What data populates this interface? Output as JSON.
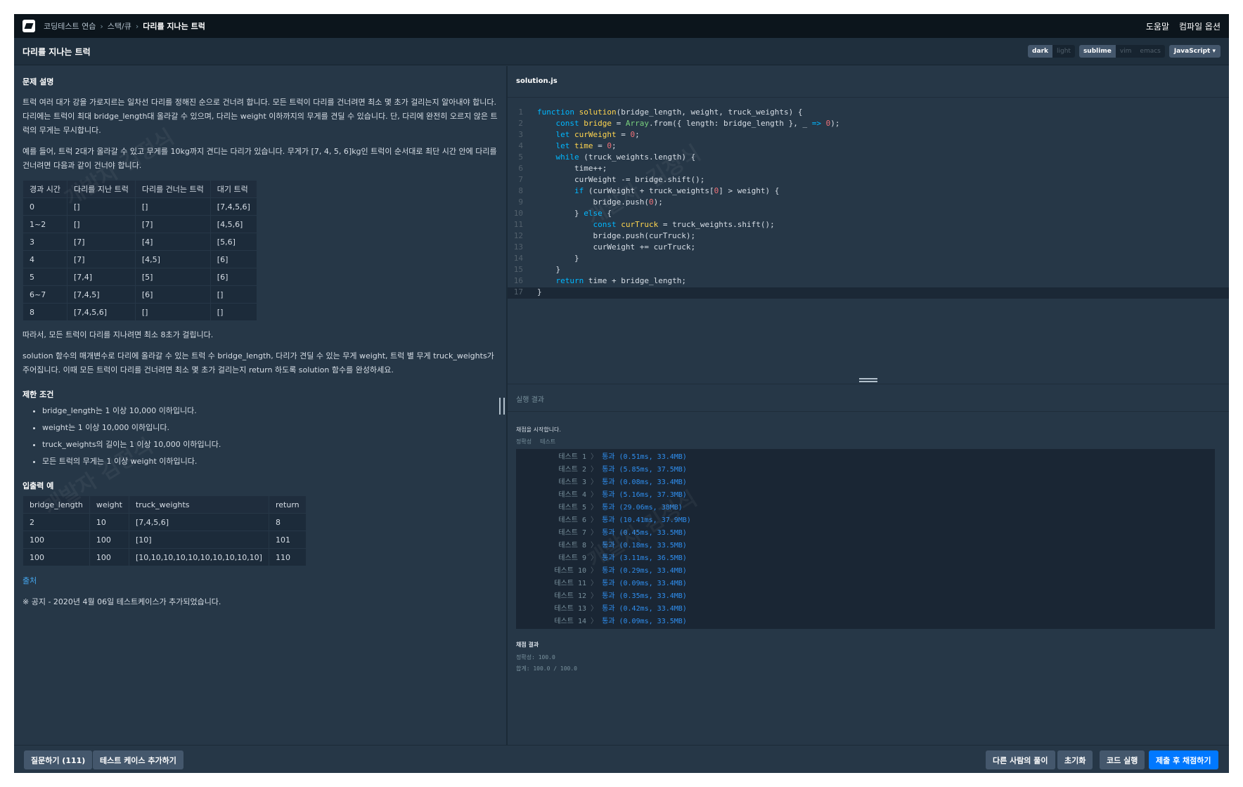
{
  "topbar": {
    "breadcrumbs": [
      "코딩테스트 연습",
      "스택/큐",
      "다리를 지나는 트럭"
    ],
    "links": [
      "도움말",
      "컴파일 옵션"
    ]
  },
  "titlebar": {
    "title": "다리를 지나는 트럭",
    "themes": [
      "dark",
      "light"
    ],
    "keymaps": [
      "sublime",
      "vim",
      "emacs"
    ],
    "language": "JavaScript",
    "caret": "▾"
  },
  "problem": {
    "description_heading": "문제 설명",
    "description": "트럭 여러 대가 강을 가로지르는 일차선 다리를 정해진 순으로 건너려 합니다. 모든 트럭이 다리를 건너려면 최소 몇 초가 걸리는지 알아내야 합니다. 다리에는 트럭이 최대 bridge_length대 올라갈 수 있으며, 다리는 weight 이하까지의 무게를 견딜 수 있습니다. 단, 다리에 완전히 오르지 않은 트럭의 무게는 무시합니다.",
    "example_intro": "예를 들어, 트럭 2대가 올라갈 수 있고 무게를 10kg까지 견디는 다리가 있습니다. 무게가 [7, 4, 5, 6]kg인 트럭이 순서대로 최단 시간 안에 다리를 건너려면 다음과 같이 건너야 합니다.",
    "timeline_headers": [
      "경과 시간",
      "다리를 지난 트럭",
      "다리를 건너는 트럭",
      "대기 트럭"
    ],
    "timeline_rows": [
      [
        "0",
        "[]",
        "[]",
        "[7,4,5,6]"
      ],
      [
        "1~2",
        "[]",
        "[7]",
        "[4,5,6]"
      ],
      [
        "3",
        "[7]",
        "[4]",
        "[5,6]"
      ],
      [
        "4",
        "[7]",
        "[4,5]",
        "[6]"
      ],
      [
        "5",
        "[7,4]",
        "[5]",
        "[6]"
      ],
      [
        "6~7",
        "[7,4,5]",
        "[6]",
        "[]"
      ],
      [
        "8",
        "[7,4,5,6]",
        "[]",
        "[]"
      ]
    ],
    "conclusion": "따라서, 모든 트럭이 다리를 지나려면 최소 8초가 걸립니다.",
    "task": "solution 함수의 매개변수로 다리에 올라갈 수 있는 트럭 수 bridge_length, 다리가 견딜 수 있는 무게 weight, 트럭 별 무게 truck_weights가 주어집니다. 이때 모든 트럭이 다리를 건너려면 최소 몇 초가 걸리는지 return 하도록 solution 함수를 완성하세요.",
    "constraints_heading": "제한 조건",
    "constraints": [
      "bridge_length는 1 이상 10,000 이하입니다.",
      "weight는 1 이상 10,000 이하입니다.",
      "truck_weights의 길이는 1 이상 10,000 이하입니다.",
      "모든 트럭의 무게는 1 이상 weight 이하입니다."
    ],
    "io_heading": "입출력 예",
    "io_headers": [
      "bridge_length",
      "weight",
      "truck_weights",
      "return"
    ],
    "io_rows": [
      [
        "2",
        "10",
        "[7,4,5,6]",
        "8"
      ],
      [
        "100",
        "100",
        "[10]",
        "101"
      ],
      [
        "100",
        "100",
        "[10,10,10,10,10,10,10,10,10,10]",
        "110"
      ]
    ],
    "source_link": "출처",
    "notice": "※ 공지 - 2020년 4월 06일 테스트케이스가 추가되었습니다."
  },
  "editor": {
    "filename": "solution.js",
    "line_numbers": [
      "1",
      "2",
      "3",
      "4",
      "5",
      "6",
      "7",
      "8",
      "9",
      "10",
      "11",
      "12",
      "13",
      "14",
      "15",
      "16",
      "17"
    ]
  },
  "run": {
    "heading": "실행 결과",
    "start_message": "채점을 시작합니다.",
    "tabs": [
      "정확성",
      "테스트"
    ],
    "tests": [
      {
        "name": "테스트 1",
        "result": "통과 (0.51ms, 33.4MB)"
      },
      {
        "name": "테스트 2",
        "result": "통과 (5.85ms, 37.5MB)"
      },
      {
        "name": "테스트 3",
        "result": "통과 (0.08ms, 33.4MB)"
      },
      {
        "name": "테스트 4",
        "result": "통과 (5.16ms, 37.3MB)"
      },
      {
        "name": "테스트 5",
        "result": "통과 (29.06ms, 38MB)"
      },
      {
        "name": "테스트 6",
        "result": "통과 (10.41ms, 37.9MB)"
      },
      {
        "name": "테스트 7",
        "result": "통과 (0.45ms, 33.5MB)"
      },
      {
        "name": "테스트 8",
        "result": "통과 (0.18ms, 33.5MB)"
      },
      {
        "name": "테스트 9",
        "result": "통과 (3.11ms, 36.5MB)"
      },
      {
        "name": "테스트 10",
        "result": "통과 (0.29ms, 33.4MB)"
      },
      {
        "name": "테스트 11",
        "result": "통과 (0.09ms, 33.4MB)"
      },
      {
        "name": "테스트 12",
        "result": "통과 (0.35ms, 33.4MB)"
      },
      {
        "name": "테스트 13",
        "result": "통과 (0.42ms, 33.4MB)"
      },
      {
        "name": "테스트 14",
        "result": "통과 (0.09ms, 33.5MB)"
      }
    ],
    "summary_heading": "채점 결과",
    "accuracy": "정확성: 100.0",
    "total": "합계: 100.0 / 100.0"
  },
  "footer": {
    "question_button": "질문하기 (111)",
    "add_testcase_button": "테스트 케이스 추가하기",
    "others_button": "다른 사람의 풀이",
    "reset_button": "초기화",
    "run_button": "코드 실행",
    "submit_button": "제출 후 채점하기"
  },
  "watermark": "개발자 김정식",
  "colors": {
    "background": "#263747",
    "topbar": "#0c151c",
    "primary_button": "#0078ff",
    "pass": "#2f8ff0",
    "keyword": "#00b7ff",
    "function": "#ffd54f",
    "number": "#f07178"
  }
}
